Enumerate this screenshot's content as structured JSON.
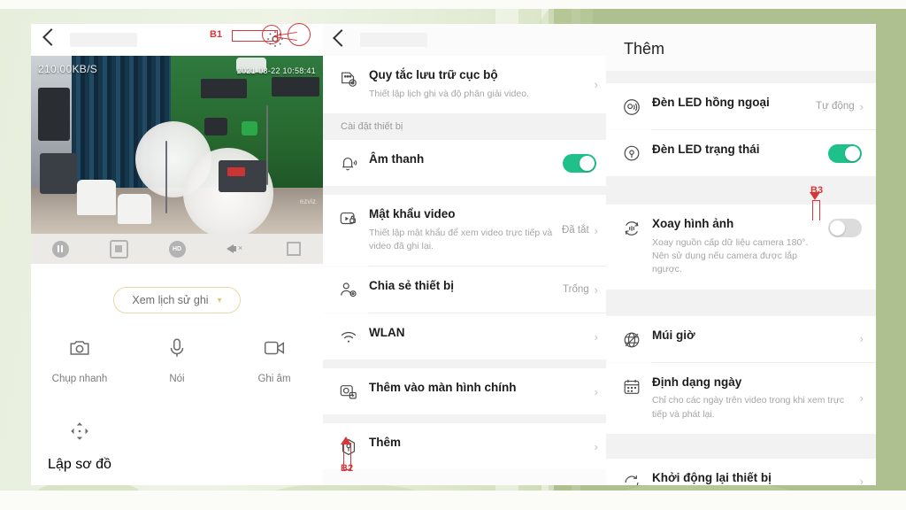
{
  "colors": {
    "background_green": "#aec08f",
    "panel_white": "#ffffff",
    "toggle_on_green": "#1fc08a",
    "toggle_off_gray": "#dcdcdc",
    "annotation_red": "#d6373a",
    "history_border": "#e3d9a8"
  },
  "live_panel": {
    "back_icon": "back-chevron-icon",
    "video": {
      "bitrate": "210.00KB/S",
      "timestamp": "2021-08-22 10:58:41",
      "watermark": "ezviz"
    },
    "controls": [
      {
        "name": "pause-button",
        "icon": "pause-icon"
      },
      {
        "name": "stop-record-button",
        "icon": "stop-square-icon"
      },
      {
        "name": "quality-button",
        "icon": "hd-icon",
        "label": "HD"
      },
      {
        "name": "mute-button",
        "icon": "speaker-mute-icon"
      },
      {
        "name": "fullscreen-button",
        "icon": "fullscreen-icon"
      }
    ],
    "history_button": {
      "label": "Xem lịch sử ghi",
      "chevron": "chevron-down-icon"
    },
    "actions": [
      {
        "label": "Chụp nhanh",
        "icon": "camera-icon"
      },
      {
        "label": "Nói",
        "icon": "microphone-icon"
      },
      {
        "label": "Ghi âm",
        "icon": "video-record-icon"
      }
    ],
    "map_action": {
      "label": "Lập sơ đồ",
      "icon": "dpad-icon"
    },
    "annotation": {
      "label": "B1",
      "target": "settings-gear-icon"
    }
  },
  "settings_panel": {
    "back_icon": "back-chevron-icon",
    "rows_top": [
      {
        "title": "Quy tắc lưu trữ cục bộ",
        "subtitle": "Thiết lập lịch ghi và độ phân giải video.",
        "icon": "sd-card-icon",
        "value": "",
        "control": "chevron"
      }
    ],
    "section_header": "Cài đặt thiết bị",
    "rows": [
      {
        "title": "Âm thanh",
        "subtitle": "",
        "icon": "bell-sound-icon",
        "value": "",
        "control": "toggle",
        "toggle_on": true
      },
      {
        "title": "Mật khẩu video",
        "subtitle": "Thiết lập mật khẩu để xem video trực tiếp và video đã ghi lại.",
        "icon": "video-lock-icon",
        "value": "Đã tắt",
        "control": "chevron"
      },
      {
        "title": "Chia sẻ thiết bị",
        "subtitle": "",
        "icon": "user-share-icon",
        "value": "Trống",
        "control": "chevron"
      },
      {
        "title": "WLAN",
        "subtitle": "",
        "icon": "wifi-icon",
        "value": "",
        "control": "chevron"
      },
      {
        "title": "Thêm vào màn hình chính",
        "subtitle": "",
        "icon": "add-to-home-icon",
        "value": "",
        "control": "chevron"
      },
      {
        "title": "Thêm",
        "subtitle": "",
        "icon": "more-settings-icon",
        "value": "",
        "control": "chevron"
      }
    ],
    "annotation": {
      "label": "B2",
      "target": "more-settings-icon"
    }
  },
  "more_panel": {
    "title": "Thêm",
    "rows": [
      {
        "title": "Đèn LED hồng ngoại",
        "subtitle": "",
        "icon": "infrared-led-icon",
        "value": "Tự động",
        "control": "chevron"
      },
      {
        "title": "Đèn LED trạng thái",
        "subtitle": "",
        "icon": "status-led-icon",
        "value": "",
        "control": "toggle",
        "toggle_on": true
      },
      {
        "title": "Xoay hình ảnh",
        "subtitle": "Xoay nguồn cấp dữ liệu camera 180°. Nên sử dụng nếu camera được lắp ngược.",
        "icon": "rotate-image-icon",
        "value": "",
        "control": "toggle",
        "toggle_on": false
      },
      {
        "title": "Múi giờ",
        "subtitle": "",
        "icon": "timezone-globe-icon",
        "value": "",
        "control": "chevron"
      },
      {
        "title": "Định dạng ngày",
        "subtitle": "Chỉ cho các ngày trên video trong khi xem trực tiếp và phát lại.",
        "icon": "calendar-icon",
        "value": "",
        "control": "chevron"
      },
      {
        "title": "Khởi động lại thiết bị",
        "subtitle": "",
        "icon": "restart-icon",
        "value": "",
        "control": "chevron"
      }
    ],
    "annotation": {
      "label": "B3",
      "target": "rotate-image-toggle"
    }
  }
}
